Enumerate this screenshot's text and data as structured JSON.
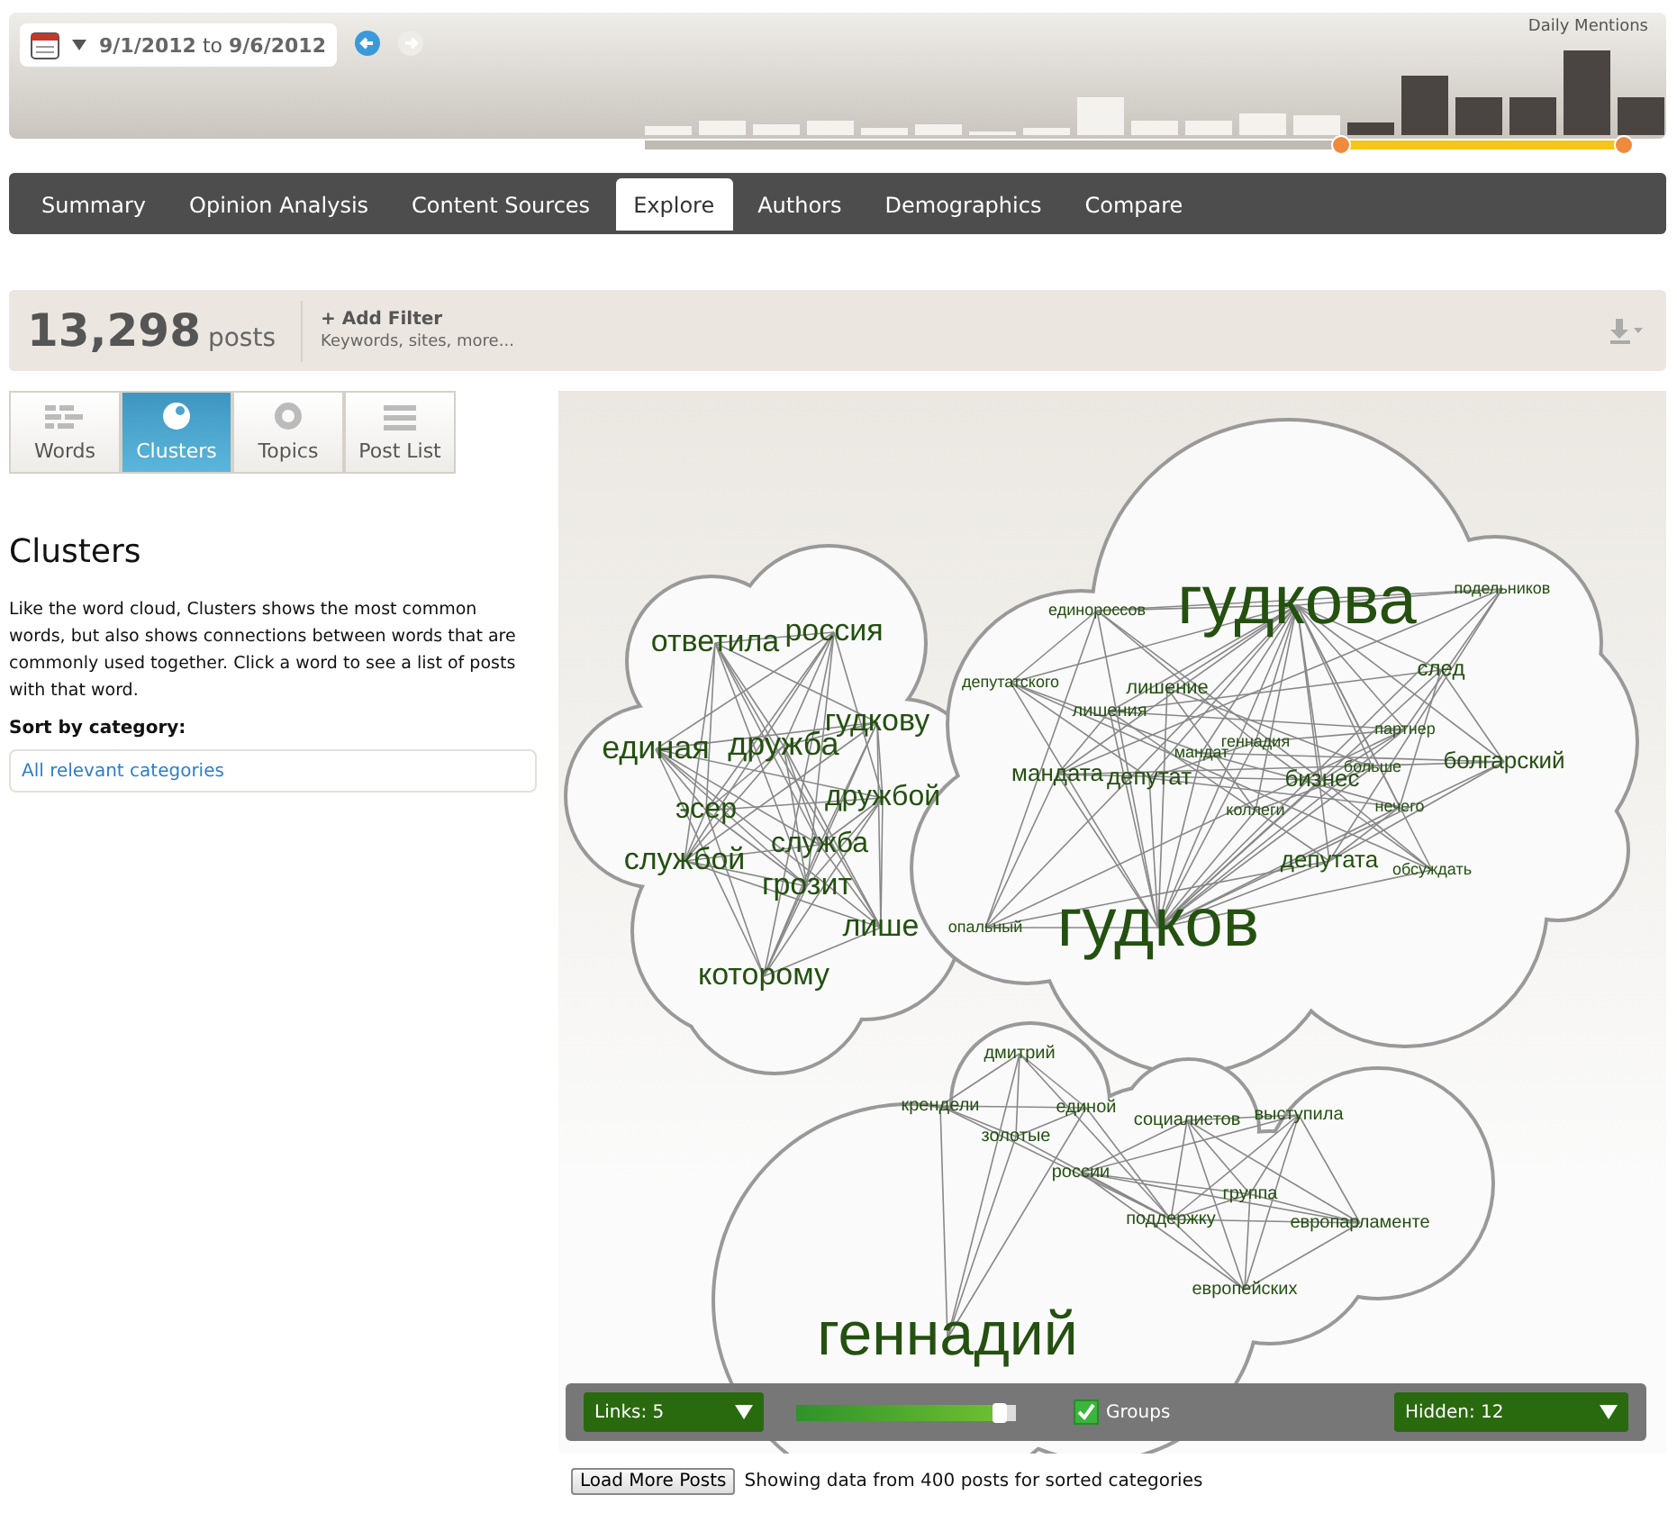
{
  "timeline": {
    "date_range": "**9/1/2012** to **9/6/2012**",
    "chart_label": "Daily Mentions",
    "range_slider": {
      "level": 0.29
    },
    "bars": [
      {
        "selected": false
      },
      {
        "selected": false
      },
      {
        "selected": false
      },
      {
        "selected": false
      },
      {
        "selected": false
      },
      {
        "selected": false
      },
      {
        "selected": false
      },
      {
        "selected": false
      },
      {
        "selected": false
      },
      {
        "selected": false
      },
      {
        "selected": false
      },
      {
        "selected": false
      },
      {
        "selected": false
      },
      {
        "selected": true
      },
      {
        "selected": true
      },
      {
        "selected": true
      },
      {
        "selected": true
      },
      {
        "selected": true
      },
      {
        "selected": true
      }
    ]
  },
  "nav_tabs": [
    {
      "label": "Summary",
      "selected": false
    },
    {
      "label": "Opinion Analysis",
      "selected": false
    },
    {
      "label": "Content Sources",
      "selected": false
    },
    {
      "label": "Explore",
      "selected": true
    },
    {
      "label": "Authors",
      "selected": false
    },
    {
      "label": "Demographics",
      "selected": false
    },
    {
      "label": "Compare",
      "selected": false
    }
  ],
  "stats": {
    "count": "13,298",
    "unit": "posts",
    "filter_label": "+ Add Filter",
    "filter_hint": "Keywords, sites, more..."
  },
  "view_tabs": [
    {
      "label": "Words",
      "kind": "words",
      "selected": false
    },
    {
      "label": "Clusters",
      "kind": "clusters",
      "selected": true
    },
    {
      "label": "Topics",
      "kind": "topics",
      "selected": false
    },
    {
      "label": "Post List",
      "kind": "list",
      "selected": false
    }
  ],
  "sidebar": {
    "title": "Clusters",
    "description": "Like the word cloud, Clusters shows the most common words, but also shows connections between words that are commonly used together. Click a word to see a list of posts with that word.",
    "sort_label": "Sort by category:",
    "sort_value": "All relevant categories"
  },
  "clusters": [
    {
      "words": [
        "ответила",
        "россия",
        "гудкову",
        "единая",
        "дружба",
        "эсер",
        "служба",
        "дружбой",
        "службой",
        "грозит",
        "лише",
        "которому"
      ]
    },
    {
      "words": [
        "гудкова",
        "подельников",
        "единороссов",
        "след",
        "депутатского",
        "лишение",
        "лишения",
        "партнер",
        "мандат",
        "геннадия",
        "больше",
        "болгарский",
        "мандата",
        "депутат",
        "бизнес",
        "коллеги",
        "нечего",
        "депутата",
        "обсуждать",
        "опальный",
        "гудков"
      ]
    },
    {
      "words": [
        "дмитрий",
        "крендели",
        "единой",
        "золотые",
        "социалистов",
        "выступила",
        "россии",
        "группа",
        "поддержку",
        "европарламенте",
        "европейских",
        "геннадий"
      ]
    }
  ],
  "controls": {
    "links": "Links: 5",
    "links_slider": {
      "level": 0.93
    },
    "groups_label": "Groups",
    "groups_checked": true,
    "hidden": "Hidden: 12"
  },
  "footer": {
    "button": "Load More Posts",
    "note": "Showing data from 400 posts for sorted categories"
  }
}
